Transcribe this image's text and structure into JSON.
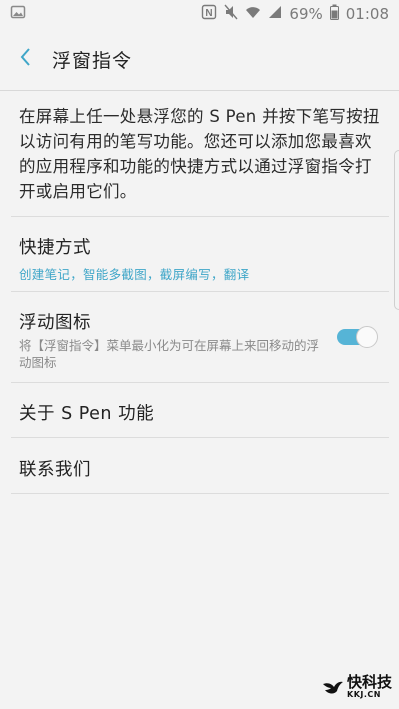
{
  "status_bar": {
    "battery": "69%",
    "time": "01:08",
    "icons": [
      "image-icon",
      "nfc-icon",
      "mute-icon",
      "wifi-icon",
      "signal-icon",
      "battery-icon"
    ]
  },
  "header": {
    "title": "浮窗指令",
    "back_icon": "chevron-left-icon"
  },
  "description": "在屏幕上任一处悬浮您的 S Pen 并按下笔写按扭以访问有用的笔写功能。您还可以添加您最喜欢的应用程序和功能的快捷方式以通过浮窗指令打开或启用它们。",
  "settings": {
    "shortcuts": {
      "title": "快捷方式",
      "subtitle": "创建笔记，智能多截图，截屏编写，翻译"
    },
    "floating_icon": {
      "title": "浮动图标",
      "subtitle": "将【浮窗指令】菜单最小化为可在屏幕上来回移动的浮动图标",
      "enabled": true
    },
    "about": {
      "title": "关于 S Pen 功能"
    },
    "contact": {
      "title": "联系我们"
    }
  },
  "watermark": {
    "name": "快科技",
    "domain": "KKJ.CN"
  },
  "colors": {
    "accent": "#3fa6c8",
    "toggle_on": "#56b4d6",
    "background": "#f3f3f3"
  }
}
